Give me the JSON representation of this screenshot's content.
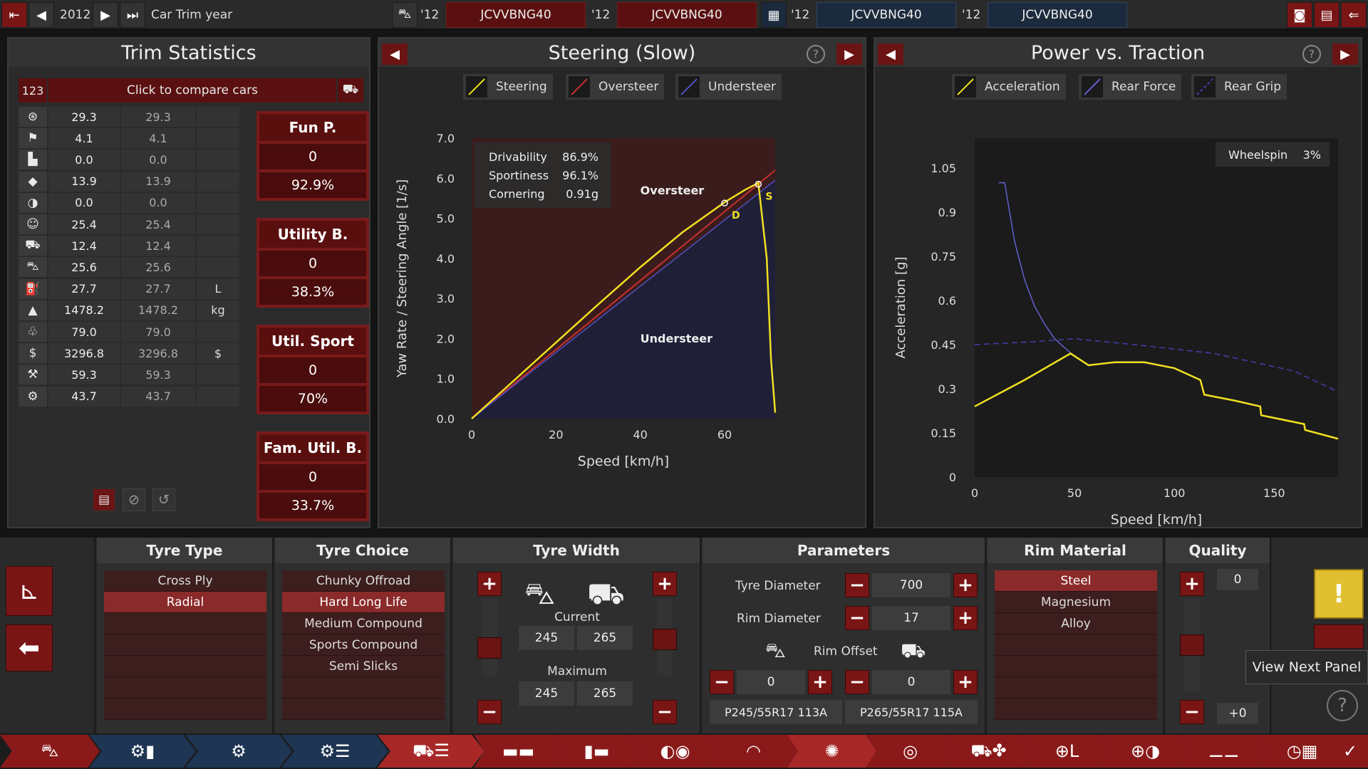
{
  "topbar": {
    "year": "2012",
    "title": "Car Trim year",
    "compare": [
      {
        "year": "'12",
        "code": "JCVVBNG40"
      },
      {
        "year": "'12",
        "code": "JCVVBNG40"
      },
      {
        "year": "'12",
        "code": "JCVVBNG40"
      },
      {
        "year": "'12",
        "code": "JCVVBNG40"
      }
    ]
  },
  "trim": {
    "title": "Trim Statistics",
    "count_badge": "123",
    "compare_label": "Click to compare cars",
    "rows": [
      {
        "icon": "steering-wheel-icon",
        "v1": "29.3",
        "v2": "29.3",
        "unit": ""
      },
      {
        "icon": "race-flag-icon",
        "v1": "4.1",
        "v2": "4.1",
        "unit": ""
      },
      {
        "icon": "seat-icon",
        "v1": "0.0",
        "v2": "0.0",
        "unit": ""
      },
      {
        "icon": "gem-icon",
        "v1": "13.9",
        "v2": "13.9",
        "unit": ""
      },
      {
        "icon": "safety-icon",
        "v1": "0.0",
        "v2": "0.0",
        "unit": ""
      },
      {
        "icon": "passengers-icon",
        "v1": "25.4",
        "v2": "25.4",
        "unit": ""
      },
      {
        "icon": "cargo-car-icon",
        "v1": "12.4",
        "v2": "12.4",
        "unit": ""
      },
      {
        "icon": "offroad-car-icon",
        "v1": "25.6",
        "v2": "25.6",
        "unit": ""
      },
      {
        "icon": "fuel-can-icon",
        "v1": "27.7",
        "v2": "27.7",
        "unit": "L"
      },
      {
        "icon": "weight-icon",
        "v1": "1478.2",
        "v2": "1478.2",
        "unit": "kg"
      },
      {
        "icon": "environment-icon",
        "v1": "79.0",
        "v2": "79.0",
        "unit": ""
      },
      {
        "icon": "cost-icon",
        "v1": "3296.8",
        "v2": "3296.8",
        "unit": "$"
      },
      {
        "icon": "service-icon",
        "v1": "59.3",
        "v2": "59.3",
        "unit": ""
      },
      {
        "icon": "engineering-icon",
        "v1": "43.7",
        "v2": "43.7",
        "unit": ""
      }
    ],
    "scores": [
      {
        "title": "Fun P.",
        "value": "0",
        "pct": "92.9%"
      },
      {
        "title": "Utility B.",
        "value": "0",
        "pct": "38.3%"
      },
      {
        "title": "Util. Sport",
        "value": "0",
        "pct": "70%"
      },
      {
        "title": "Fam. Util. B.",
        "value": "0",
        "pct": "33.7%"
      }
    ]
  },
  "steering": {
    "title": "Steering (Slow)",
    "legend": [
      "Steering",
      "Oversteer",
      "Understeer"
    ],
    "colors": {
      "steering": "#f0e020",
      "oversteer": "#c83030",
      "understeer": "#5050c0"
    },
    "info": [
      {
        "label": "Drivability",
        "value": "86.9%"
      },
      {
        "label": "Sportiness",
        "value": "96.1%"
      },
      {
        "label": "Cornering",
        "value": "0.91g"
      }
    ],
    "region_labels": {
      "over": "Oversteer",
      "under": "Understeer"
    },
    "markers": {
      "d": "D",
      "s": "S"
    },
    "chart_data": {
      "type": "line",
      "xlabel": "Speed [km/h]",
      "ylabel": "Yaw Rate / Steering Angle [1/s]",
      "xlim": [
        0,
        72
      ],
      "ylim": [
        0,
        7.0
      ],
      "xticks": [
        "0",
        "20",
        "40",
        "60"
      ],
      "yticks": [
        "0.0",
        "1.0",
        "2.0",
        "3.0",
        "4.0",
        "5.0",
        "6.0",
        "7.0"
      ],
      "series": [
        {
          "name": "Steering",
          "x": [
            0,
            10,
            20,
            30,
            40,
            50,
            60,
            65,
            68,
            70,
            71,
            72
          ],
          "y": [
            0,
            0.95,
            1.9,
            2.85,
            3.78,
            4.65,
            5.4,
            5.72,
            5.88,
            4.0,
            1.5,
            0.15
          ]
        },
        {
          "name": "Oversteer",
          "x": [
            0,
            72
          ],
          "y": [
            0,
            6.2
          ]
        },
        {
          "name": "Understeer",
          "x": [
            0,
            72
          ],
          "y": [
            0,
            5.95
          ]
        }
      ],
      "points": [
        {
          "label": "D",
          "x": 60,
          "y": 5.38
        },
        {
          "label": "S",
          "x": 68,
          "y": 5.85
        }
      ]
    }
  },
  "power": {
    "title": "Power vs. Traction",
    "legend": [
      "Acceleration",
      "Rear Force",
      "Rear Grip"
    ],
    "colors": {
      "acceleration": "#f0e020",
      "rear_force": "#6060d0",
      "rear_grip": "#4040b0"
    },
    "wheelspin_label": "Wheelspin",
    "wheelspin_value": "3%",
    "chart_data": {
      "type": "line",
      "xlabel": "Speed [km/h]",
      "ylabel": "Acceleration [g]",
      "xlim": [
        0,
        182
      ],
      "ylim": [
        0,
        1.05
      ],
      "xticks": [
        "0",
        "50",
        "100",
        "150"
      ],
      "yticks": [
        "0",
        "0.15",
        "0.3",
        "0.45",
        "0.6",
        "0.75",
        "0.9",
        "1.05"
      ],
      "series": [
        {
          "name": "Acceleration",
          "x": [
            0,
            25,
            48,
            57,
            70,
            85,
            100,
            113,
            115,
            130,
            143,
            143.5,
            165,
            165.5,
            182
          ],
          "y": [
            0.24,
            0.33,
            0.42,
            0.38,
            0.39,
            0.39,
            0.37,
            0.33,
            0.28,
            0.26,
            0.24,
            0.21,
            0.18,
            0.16,
            0.13
          ]
        },
        {
          "name": "Rear Force",
          "x": [
            12,
            15,
            20,
            25,
            30,
            35,
            40,
            45,
            50
          ],
          "y": [
            1.0,
            1.0,
            0.8,
            0.67,
            0.58,
            0.52,
            0.47,
            0.44,
            0.41
          ]
        },
        {
          "name": "Rear Grip",
          "x": [
            0,
            30,
            50,
            80,
            120,
            160,
            182
          ],
          "y": [
            0.45,
            0.46,
            0.47,
            0.45,
            0.42,
            0.36,
            0.29
          ]
        }
      ]
    }
  },
  "tyre_type": {
    "title": "Tyre Type",
    "items": [
      "Cross Ply",
      "Radial",
      "",
      "",
      "",
      "",
      ""
    ],
    "selected": 1
  },
  "tyre_choice": {
    "title": "Tyre Choice",
    "items": [
      "Chunky Offroad",
      "Hard Long Life",
      "Medium Compound",
      "Sports Compound",
      "Semi Slicks",
      "",
      ""
    ],
    "selected": 1
  },
  "tyre_width": {
    "title": "Tyre Width",
    "current_label": "Current",
    "current": [
      "245",
      "265"
    ],
    "maximum_label": "Maximum",
    "maximum": [
      "245",
      "265"
    ]
  },
  "parameters": {
    "title": "Parameters",
    "tyre_diameter_label": "Tyre Diameter",
    "tyre_diameter": "700",
    "rim_diameter_label": "Rim Diameter",
    "rim_diameter": "17",
    "rim_offset_label": "Rim Offset",
    "rim_offset_front": "0",
    "rim_offset_rear": "0",
    "tyre_code_front": "P245/55R17 113A",
    "tyre_code_rear": "P265/55R17  115A"
  },
  "rim_material": {
    "title": "Rim Material",
    "items": [
      "Steel",
      "Magnesium",
      "Alloy",
      "",
      "",
      "",
      ""
    ],
    "selected": 0
  },
  "quality": {
    "title": "Quality",
    "value": "0",
    "delta": "+0"
  },
  "tooltip": "View Next Panel"
}
